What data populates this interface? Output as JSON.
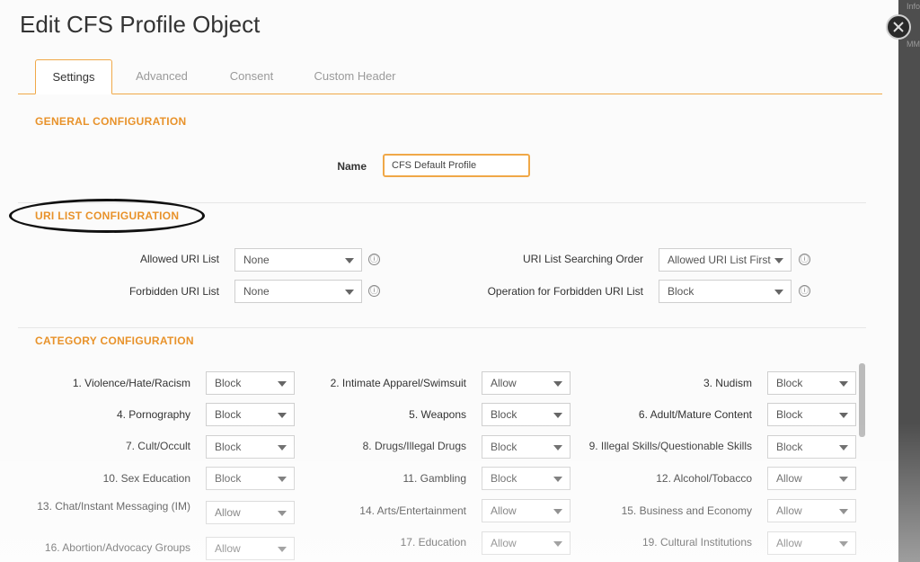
{
  "dialog": {
    "title": "Edit CFS Profile Object"
  },
  "tabs": [
    {
      "label": "Settings",
      "active": true
    },
    {
      "label": "Advanced",
      "active": false
    },
    {
      "label": "Consent",
      "active": false
    },
    {
      "label": "Custom Header",
      "active": false
    }
  ],
  "general": {
    "heading": "GENERAL CONFIGURATION",
    "name_label": "Name",
    "name_value": "CFS Default Profile"
  },
  "uri": {
    "heading": "URI LIST CONFIGURATION",
    "allowed_label": "Allowed URI List",
    "allowed_value": "None",
    "forbidden_label": "Forbidden URI List",
    "forbidden_value": "None",
    "order_label": "URI List Searching Order",
    "order_value": "Allowed URI List First",
    "operation_label": "Operation for Forbidden URI List",
    "operation_value": "Block",
    "info_glyph": "ⓘ"
  },
  "category": {
    "heading": "CATEGORY CONFIGURATION",
    "items": [
      {
        "label": "1. Violence/Hate/Racism",
        "value": "Block"
      },
      {
        "label": "2. Intimate Apparel/Swimsuit",
        "value": "Allow"
      },
      {
        "label": "3. Nudism",
        "value": "Block"
      },
      {
        "label": "4. Pornography",
        "value": "Block"
      },
      {
        "label": "5. Weapons",
        "value": "Block"
      },
      {
        "label": "6. Adult/Mature Content",
        "value": "Block"
      },
      {
        "label": "7. Cult/Occult",
        "value": "Block"
      },
      {
        "label": "8. Drugs/Illegal Drugs",
        "value": "Block"
      },
      {
        "label": "9. Illegal Skills/Questionable Skills",
        "value": "Block"
      },
      {
        "label": "10. Sex Education",
        "value": "Block"
      },
      {
        "label": "11. Gambling",
        "value": "Block"
      },
      {
        "label": "12. Alcohol/Tobacco",
        "value": "Allow"
      },
      {
        "label": "13. Chat/Instant Messaging (IM)",
        "value": "Allow"
      },
      {
        "label": "14. Arts/Entertainment",
        "value": "Allow"
      },
      {
        "label": "15. Business and Economy",
        "value": "Allow"
      },
      {
        "label": "16. Abortion/Advocacy Groups",
        "value": "Allow"
      },
      {
        "label": "17. Education",
        "value": "Allow"
      },
      {
        "label": "19. Cultural Institutions",
        "value": "Allow"
      }
    ]
  },
  "backdrop": {
    "text1": "Info",
    "text2": "MM"
  },
  "colors": {
    "accent": "#f0a848",
    "heading": "#e8922a"
  }
}
